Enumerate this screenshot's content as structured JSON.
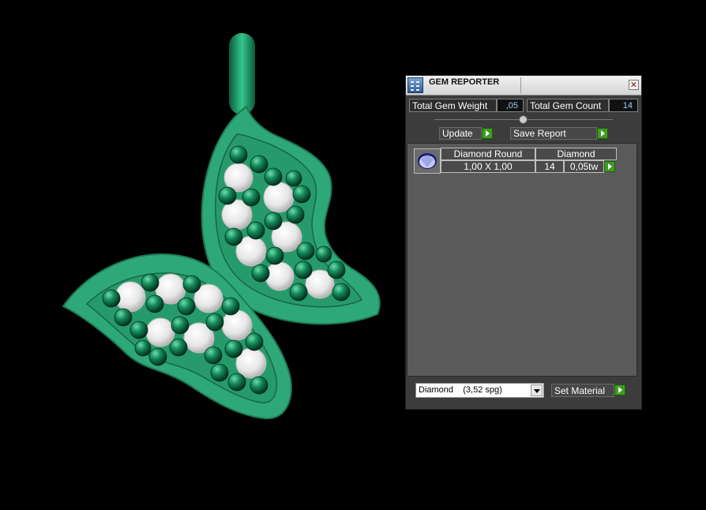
{
  "panel": {
    "title": "GEM REPORTER",
    "total_gem_weight_label": "Total Gem Weight",
    "total_gem_weight_value": ",05",
    "total_gem_count_label": "Total Gem Count",
    "total_gem_count_value": "14",
    "update_label": "Update",
    "save_report_label": "Save Report",
    "list": {
      "rows": [
        {
          "shape": "Diamond Round",
          "material": "Diamond",
          "size": "1,00 X 1,00",
          "count": "14",
          "weight": "0,05tw"
        }
      ]
    },
    "material_select_value": "Diamond    (3,52 spg)",
    "set_material_label": "Set Material"
  },
  "colors": {
    "metal": "#2fa879",
    "gem_green": "#0d6b47",
    "diamond": "#e8e8e8",
    "accent_green": "#3f9c22"
  },
  "icons": [
    "gem-reporter-icon",
    "close-icon",
    "diamond-round-icon",
    "dropdown-arrow-icon",
    "play-arrow-icon"
  ]
}
